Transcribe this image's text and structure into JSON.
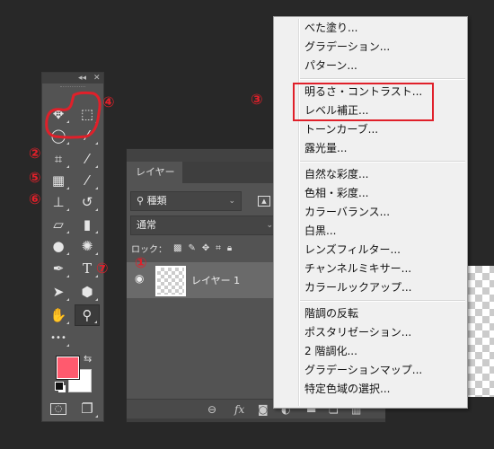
{
  "toolbar": {
    "collapse_label": "◂◂",
    "close_label": "✕",
    "tools": [
      {
        "name": "move-tool",
        "icon": "move-icon",
        "glyph": "✥"
      },
      {
        "name": "marquee-tool",
        "icon": "rect-marquee-icon",
        "glyph": "⬚"
      },
      {
        "name": "lasso-tool",
        "icon": "lasso-icon",
        "glyph": "◯"
      },
      {
        "name": "magic-wand-tool",
        "icon": "magic-wand-icon",
        "glyph": "⁄"
      },
      {
        "name": "crop-tool",
        "icon": "crop-icon",
        "glyph": "⌗"
      },
      {
        "name": "eyedropper-tool",
        "icon": "eyedropper-icon",
        "glyph": "⁄"
      },
      {
        "name": "healing-brush-tool",
        "icon": "bandage-icon",
        "glyph": "▦"
      },
      {
        "name": "brush-tool",
        "icon": "brush-icon",
        "glyph": "⁄"
      },
      {
        "name": "clone-stamp-tool",
        "icon": "stamp-icon",
        "glyph": "⊥"
      },
      {
        "name": "history-brush-tool",
        "icon": "history-brush-icon",
        "glyph": "↺"
      },
      {
        "name": "eraser-tool",
        "icon": "eraser-icon",
        "glyph": "▱"
      },
      {
        "name": "gradient-tool",
        "icon": "gradient-icon",
        "glyph": "▮"
      },
      {
        "name": "blur-tool",
        "icon": "drop-icon",
        "glyph": "●"
      },
      {
        "name": "sponge-tool",
        "icon": "sponge-icon",
        "glyph": "✺"
      },
      {
        "name": "pen-tool",
        "icon": "pen-icon",
        "glyph": "✒"
      },
      {
        "name": "type-tool",
        "icon": "type-icon",
        "glyph": "T"
      },
      {
        "name": "path-selection-tool",
        "icon": "arrow-icon",
        "glyph": "➤"
      },
      {
        "name": "shape-tool",
        "icon": "hexagon-icon",
        "glyph": "⬢"
      },
      {
        "name": "hand-tool",
        "icon": "hand-icon",
        "glyph": "✋"
      },
      {
        "name": "zoom-tool",
        "icon": "zoom-icon",
        "glyph": "⚲"
      },
      {
        "name": "more-tools",
        "icon": "more-icon",
        "glyph": "•••"
      }
    ],
    "foreground_color": "#ff5a6e",
    "background_color": "#ffffff",
    "swap_glyph": "⇆",
    "quick_mask_glyph": "◌",
    "screen_mode_glyph": "❐"
  },
  "layers_panel": {
    "tab_label": "レイヤー",
    "filter": {
      "icon": "search-icon",
      "value": "種類"
    },
    "blend_mode": "通常",
    "lock_label": "ロック：",
    "lock_icons": [
      "lock-transparency-icon",
      "lock-paint-icon",
      "lock-position-icon",
      "lock-artboard-icon",
      "lock-all-icon"
    ],
    "layers": [
      {
        "name": "レイヤー 1",
        "visible": true
      }
    ],
    "footer": {
      "link": "⊖",
      "fx": "fx",
      "mask": "◙",
      "adjust": "◐",
      "group": "▬",
      "new": "❏",
      "delete": "▥"
    }
  },
  "menu": {
    "groups": [
      [
        "べた塗り...",
        "グラデーション...",
        "パターン..."
      ],
      [
        "明るさ・コントラスト...",
        "レベル補正...",
        "トーンカーブ...",
        "露光量..."
      ],
      [
        "自然な彩度...",
        "色相・彩度...",
        "カラーバランス...",
        "白黒...",
        "レンズフィルター...",
        "チャンネルミキサー...",
        "カラールックアップ..."
      ],
      [
        "階調の反転",
        "ポスタリゼーション...",
        "2 階調化...",
        "グラデーションマップ...",
        "特定色域の選択..."
      ]
    ]
  },
  "annotations": {
    "n1": "①",
    "n2": "②",
    "n3": "③",
    "n4": "④",
    "n5": "⑤",
    "n6": "⑥",
    "n7": "⑦",
    "color": "#e0202a"
  }
}
